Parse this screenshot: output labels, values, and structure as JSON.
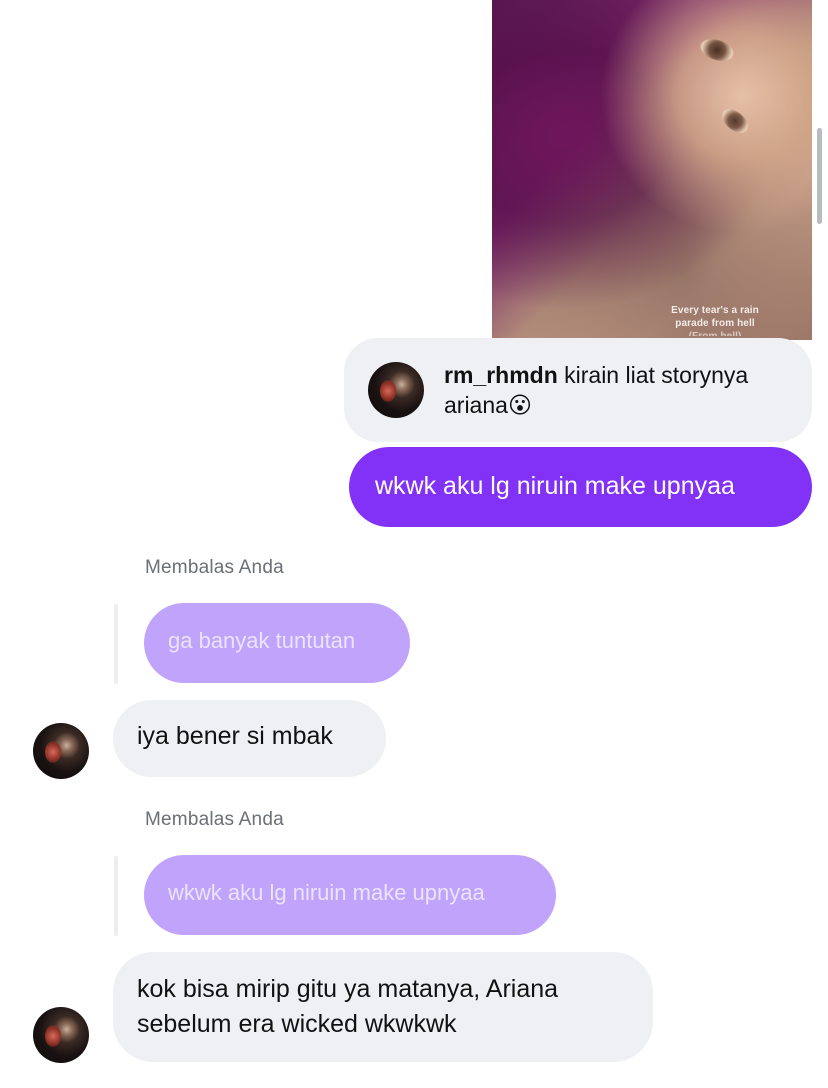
{
  "story": {
    "caption_line1": "Every tear's a rain",
    "caption_line2": "parade from hell",
    "caption_line3": "(From hell)"
  },
  "story_reply": {
    "username": "rm_rhmdn",
    "message": "kirain liat storynya ariana",
    "emoji": "😮"
  },
  "messages": [
    {
      "id": "out1",
      "direction": "outgoing",
      "text": "wkwk aku lg niruin make upnyaa"
    },
    {
      "id": "reply_label1",
      "text": "Membalas Anda"
    },
    {
      "id": "quote1",
      "text": "ga banyak tuntutan"
    },
    {
      "id": "in1",
      "direction": "incoming",
      "text": "iya bener si mbak"
    },
    {
      "id": "reply_label2",
      "text": "Membalas Anda"
    },
    {
      "id": "quote2",
      "text": "wkwk aku lg niruin make upnyaa"
    },
    {
      "id": "in2_line1",
      "text": "kok bisa mirip gitu ya matanya, Ariana"
    },
    {
      "id": "in2_line2",
      "text": "sebelum era wicked wkwkwk"
    }
  ],
  "colors": {
    "outgoing_bubble": "#8132f6",
    "quoted_bubble": "#c0a4fb",
    "incoming_bubble": "#eef0f3",
    "label_text": "#6b6f76"
  }
}
